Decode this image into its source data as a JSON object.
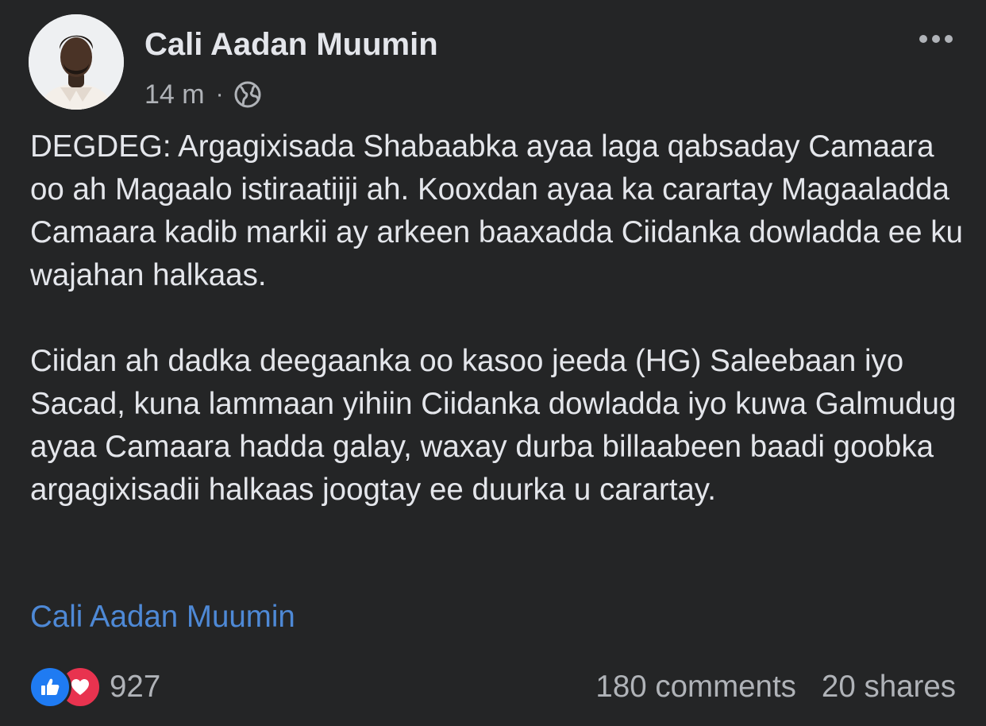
{
  "post": {
    "author": "Cali Aadan Muumin",
    "time": "14 m",
    "separator": "·",
    "privacy_icon": "globe-icon",
    "menu_icon": "more-options-icon",
    "paragraphs": [
      "DEGDEG: Argagixisada Shabaabka ayaa laga qabsaday Camaara oo ah Magaalo istiraatiiji ah. Kooxdan ayaa ka carartay Magaaladda Camaara kadib markii ay arkeen baaxadda Ciidanka dowladda ee ku wajahan halkaas.",
      "Ciidan ah dadka deegaanka oo kasoo jeeda (HG) Saleebaan iyo Sacad, kuna lammaan yihiin Ciidanka dowladda iyo kuwa Galmudug ayaa Camaara hadda galay, waxay durba billaabeen baadi goobka argagixisadii halkaas joogtay ee duurka u carartay."
    ],
    "tag_link": "Cali Aadan Muumin"
  },
  "footer": {
    "reaction_count": "927",
    "reaction_icons": [
      "like-icon",
      "love-icon"
    ],
    "comments": "180 comments",
    "shares": "20 shares"
  },
  "colors": {
    "background": "#242526",
    "primary_text": "#e4e6eb",
    "secondary_text": "#b0b3b8",
    "link": "#4e89d6",
    "like": "#1f7bf2",
    "love": "#e8334f"
  }
}
